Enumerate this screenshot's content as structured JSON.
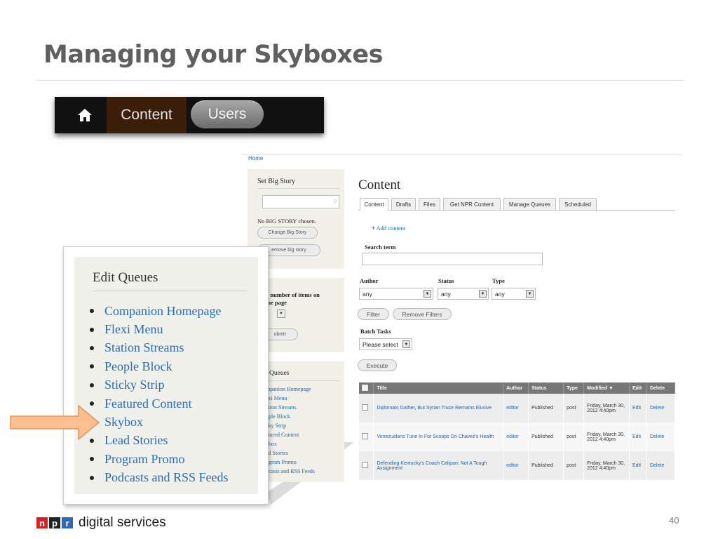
{
  "slide": {
    "title": "Managing your Skyboxes",
    "page_number": "40"
  },
  "toolbar": {
    "home_icon": "home-icon",
    "content_label": "Content",
    "users_label": "Users"
  },
  "screenshot": {
    "breadcrumb": "Home",
    "sidebar": {
      "big_story": {
        "title": "Set Big Story",
        "status": "No BIG STORY chosen.",
        "change_button": "Change Big Story",
        "remove_button": "emove big story"
      },
      "max_items": {
        "label_line1": "x number of items on",
        "label_line2": "me page",
        "submit_button": "ubmit"
      },
      "queues": {
        "title": "t Queues",
        "items": [
          "mpanion Homepage",
          "exi Menu",
          "ation Streams",
          "ople Block",
          "cky Strip",
          "atured Content",
          "ybox",
          "ad Stories",
          "ogram Promo",
          "dcasts and RSS Feeds"
        ]
      }
    },
    "main": {
      "title": "Content",
      "tabs": [
        "Content",
        "Drafts",
        "Files",
        "Get NPR Content",
        "Manage Queues",
        "Scheduled"
      ],
      "add_content": "Add content",
      "search_label": "Search term",
      "filters": {
        "author_label": "Author",
        "author_value": "any",
        "status_label": "Status",
        "status_value": "any",
        "type_label": "Type",
        "type_value": "any"
      },
      "filter_button": "Filter",
      "remove_filters_button": "Remove Filters",
      "batch_label": "Batch Tasks",
      "batch_value": "Please select",
      "execute_button": "Execute",
      "table": {
        "headers": [
          "Title",
          "Author",
          "Status",
          "Type",
          "Modified",
          "Edit",
          "Delete"
        ],
        "rows": [
          {
            "title": "Diplomats Gather, But Syrian Truce Remains Elusive",
            "author": "editor",
            "status": "Published",
            "type": "post",
            "modified": "Friday, March 30, 2012 4:40pm",
            "edit": "Edit",
            "delete": "Delete"
          },
          {
            "title": "Venezuelans Tune In For Scoops On Chavez's Health",
            "author": "editor",
            "status": "Published",
            "type": "post",
            "modified": "Friday, March 30, 2012 4:40pm",
            "edit": "Edit",
            "delete": "Delete"
          },
          {
            "title": "Defending Kentucky's Coach Calipari: Not A Tough Assignment",
            "author": "editor",
            "status": "Published",
            "type": "post",
            "modified": "Friday, March 30, 2012 4:40pm",
            "edit": "Edit",
            "delete": "Delete"
          }
        ]
      }
    }
  },
  "callout": {
    "title": "Edit Queues",
    "items": [
      "Companion Homepage",
      "Flexi Menu",
      "Station Streams",
      "People Block",
      "Sticky Strip",
      "Featured Content",
      "Skybox",
      "Lead Stories",
      "Program Promo",
      "Podcasts and RSS Feeds"
    ],
    "highlighted_item": "Skybox"
  },
  "footer": {
    "logo_letters": [
      "n",
      "p",
      "r"
    ],
    "logo_colors": [
      "#d62021",
      "#222222",
      "#3267b5"
    ],
    "brand_text": "digital services"
  },
  "colors": {
    "link": "#2b6bb5",
    "arrow_fill": "#fbbf8f",
    "arrow_stroke": "#e8935a"
  }
}
